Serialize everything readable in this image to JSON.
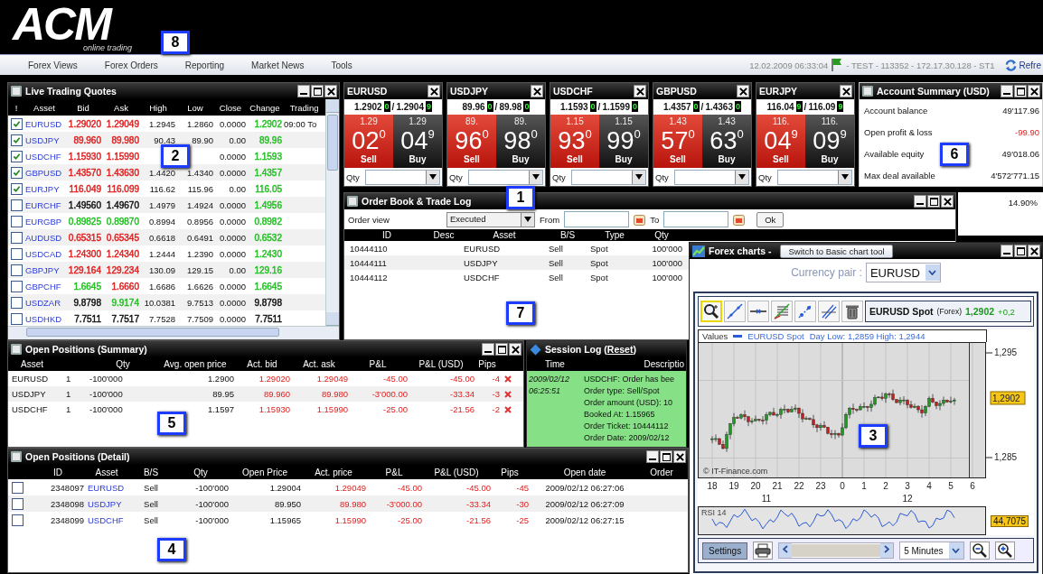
{
  "header": {
    "logo": "ACM",
    "tagline": "online trading"
  },
  "menu": [
    {
      "label": "Forex Views"
    },
    {
      "label": "Forex Orders"
    },
    {
      "label": "Reporting"
    },
    {
      "label": "Market News"
    },
    {
      "label": "Tools"
    }
  ],
  "status": {
    "datetime": "12.02.2009 06:33:04",
    "session": "- TEST - 113352 - 172.17.30.128 - ST1",
    "refresh": "Refre"
  },
  "quotes": {
    "title": "Live Trading Quotes",
    "columns": [
      "!",
      "Asset",
      "Bid",
      "Ask",
      "High",
      "Low",
      "Close",
      "Change",
      "Trading"
    ],
    "rows": [
      {
        "checked": true,
        "asset": "EURUSD",
        "bid": {
          "text": "1.29020",
          "color": "#e02020"
        },
        "ask": {
          "text": "1.29049",
          "color": "#e02020"
        },
        "high": "1.2945",
        "low": "1.2860",
        "close": "0.0000",
        "change": {
          "text": "1.2902",
          "color": "#22c022"
        },
        "trading": "09:00 To"
      },
      {
        "checked": true,
        "asset": "USDJPY",
        "bid": {
          "text": "89.960",
          "color": "#e02020"
        },
        "ask": {
          "text": "89.980",
          "color": "#e02020"
        },
        "high": "90.43",
        "low": "89.90",
        "close": "0.00",
        "change": {
          "text": "89.96",
          "color": "#22c022"
        }
      },
      {
        "checked": true,
        "asset": "USDCHF",
        "bid": {
          "text": "1.15930",
          "color": "#e02020"
        },
        "ask": {
          "text": "1.15990",
          "color": "#e02020"
        },
        "close": "0.0000",
        "change": {
          "text": "1.1593",
          "color": "#22c022"
        }
      },
      {
        "checked": true,
        "asset": "GBPUSD",
        "bid": {
          "text": "1.43570",
          "color": "#e02020"
        },
        "ask": {
          "text": "1.43630",
          "color": "#e02020"
        },
        "high": "1.4420",
        "low": "1.4340",
        "close": "0.0000",
        "change": {
          "text": "1.4357",
          "color": "#22c022"
        }
      },
      {
        "checked": true,
        "asset": "EURJPY",
        "bid": {
          "text": "116.049",
          "color": "#e02020"
        },
        "ask": {
          "text": "116.099",
          "color": "#e02020"
        },
        "high": "116.62",
        "low": "115.96",
        "close": "0.00",
        "change": {
          "text": "116.05",
          "color": "#22c022"
        }
      },
      {
        "checked": false,
        "asset": "EURCHF",
        "bid": {
          "text": "1.49560",
          "color": "#111111"
        },
        "ask": {
          "text": "1.49670",
          "color": "#111111"
        },
        "high": "1.4979",
        "low": "1.4924",
        "close": "0.0000",
        "change": {
          "text": "1.4956",
          "color": "#22c022"
        }
      },
      {
        "checked": false,
        "asset": "EURGBP",
        "bid": {
          "text": "0.89825",
          "color": "#22c022"
        },
        "ask": {
          "text": "0.89870",
          "color": "#22c022"
        },
        "high": "0.8994",
        "low": "0.8956",
        "close": "0.0000",
        "change": {
          "text": "0.8982",
          "color": "#22c022"
        }
      },
      {
        "checked": false,
        "asset": "AUDUSD",
        "bid": {
          "text": "0.65315",
          "color": "#e02020"
        },
        "ask": {
          "text": "0.65345",
          "color": "#e02020"
        },
        "high": "0.6618",
        "low": "0.6491",
        "close": "0.0000",
        "change": {
          "text": "0.6532",
          "color": "#22c022"
        }
      },
      {
        "checked": false,
        "asset": "USDCAD",
        "bid": {
          "text": "1.24300",
          "color": "#e02020"
        },
        "ask": {
          "text": "1.24340",
          "color": "#e02020"
        },
        "high": "1.2444",
        "low": "1.2390",
        "close": "0.0000",
        "change": {
          "text": "1.2430",
          "color": "#22c022"
        }
      },
      {
        "checked": false,
        "asset": "GBPJPY",
        "bid": {
          "text": "129.164",
          "color": "#e02020"
        },
        "ask": {
          "text": "129.234",
          "color": "#e02020"
        },
        "high": "130.09",
        "low": "129.15",
        "close": "0.00",
        "change": {
          "text": "129.16",
          "color": "#22c022"
        }
      },
      {
        "checked": false,
        "asset": "GBPCHF",
        "bid": {
          "text": "1.6645",
          "color": "#22c022"
        },
        "ask": {
          "text": "1.6660",
          "color": "#e02020"
        },
        "high": "1.6686",
        "low": "1.6626",
        "close": "0.0000",
        "change": {
          "text": "1.6645",
          "color": "#22c022"
        }
      },
      {
        "checked": false,
        "asset": "USDZAR",
        "bid": {
          "text": "9.8798",
          "color": "#111111"
        },
        "ask": {
          "text": "9.9174",
          "color": "#22c022"
        },
        "high": "10.0381",
        "low": "9.7513",
        "close": "0.0000",
        "change": {
          "text": "9.8798",
          "color": "#111111"
        }
      },
      {
        "checked": false,
        "asset": "USDHKD",
        "bid": {
          "text": "7.7511",
          "color": "#111111"
        },
        "ask": {
          "text": "7.7517",
          "color": "#111111"
        },
        "high": "7.7528",
        "low": "7.7509",
        "close": "0.0000",
        "change": {
          "text": "7.7511",
          "color": "#111111"
        }
      }
    ]
  },
  "tickers": [
    {
      "pair": "EURUSD",
      "bid": "1.2902",
      "bid_pip": "0",
      "separator": "/",
      "ask": "1.2904",
      "ask_pip": "9",
      "sell_prefix": "1.29",
      "sell_main": "02",
      "sell_frac": "0",
      "buy_prefix": "1.29",
      "buy_main": "04",
      "buy_frac": "9",
      "sell": "Sell",
      "buy": "Buy",
      "qty": "Qty"
    },
    {
      "pair": "USDJPY",
      "bid": "89.96",
      "bid_pip": "0",
      "separator": "/",
      "ask": "89.98",
      "ask_pip": "0",
      "sell_prefix": "89.",
      "sell_main": "96",
      "sell_frac": "0",
      "buy_prefix": "89.",
      "buy_main": "98",
      "buy_frac": "0",
      "sell": "Sell",
      "buy": "Buy",
      "qty": "Qty"
    },
    {
      "pair": "USDCHF",
      "bid": "1.1593",
      "bid_pip": "0",
      "separator": "/",
      "ask": "1.1599",
      "ask_pip": "0",
      "sell_prefix": "1.15",
      "sell_main": "93",
      "sell_frac": "0",
      "buy_prefix": "1.15",
      "buy_main": "99",
      "buy_frac": "0",
      "sell": "Sell",
      "buy": "Buy",
      "qty": "Qty"
    },
    {
      "pair": "GBPUSD",
      "bid": "1.4357",
      "bid_pip": "0",
      "separator": "/",
      "ask": "1.4363",
      "ask_pip": "0",
      "sell_prefix": "1.43",
      "sell_main": "57",
      "sell_frac": "0",
      "buy_prefix": "1.43",
      "buy_main": "63",
      "buy_frac": "0",
      "sell": "Sell",
      "buy": "Buy",
      "qty": "Qty"
    },
    {
      "pair": "EURJPY",
      "bid": "116.04",
      "bid_pip": "9",
      "separator": "/",
      "ask": "116.09",
      "ask_pip": "9",
      "sell_prefix": "116.",
      "sell_main": "04",
      "sell_frac": "9",
      "buy_prefix": "116.",
      "buy_main": "09",
      "buy_frac": "9",
      "sell": "Sell",
      "buy": "Buy",
      "qty": "Qty"
    }
  ],
  "account": {
    "title": "Account Summary (USD)",
    "rows": [
      {
        "label": "Account balance",
        "value": "49'117.96",
        "negative": false
      },
      {
        "label": "Open profit & loss",
        "value": "-99.90",
        "negative": true
      },
      {
        "label": "Available equity",
        "value": "49'018.06",
        "negative": false
      },
      {
        "label": "Max deal available",
        "value": "4'572'771.15",
        "negative": false
      }
    ]
  },
  "margin_panel": {
    "value": "14.90%"
  },
  "order_book": {
    "title": "Order Book & Trade Log",
    "order_view_label": "Order view",
    "view": "Executed",
    "from_label": "From",
    "to_label": "To",
    "ok": "Ok",
    "columns": [
      "ID",
      "Desc",
      "Asset",
      "B/S",
      "Type",
      "Qty"
    ],
    "rows": [
      {
        "id": "10444110",
        "asset": "EURUSD",
        "side": "Sell",
        "type": "Spot",
        "qty": "100'000"
      },
      {
        "id": "10444111",
        "asset": "USDJPY",
        "side": "Sell",
        "type": "Spot",
        "qty": "100'000"
      },
      {
        "id": "10444112",
        "asset": "USDCHF",
        "side": "Sell",
        "type": "Spot",
        "qty": "100'000"
      }
    ]
  },
  "summary": {
    "title": "Open Positions (Summary)",
    "columns": [
      "Asset",
      "Qty",
      "Avg. open price",
      "Act. bid",
      "Act. ask",
      "P&L",
      "P&L (USD)",
      "Pips"
    ],
    "rows": [
      {
        "asset": "EURUSD",
        "count": "1",
        "qty": "-100'000",
        "avg": "1.2900",
        "bid": "1.29020",
        "ask": "1.29049",
        "pl": "-45.00",
        "pl_usd": "-45.00",
        "pips": "-4"
      },
      {
        "asset": "USDJPY",
        "count": "1",
        "qty": "-100'000",
        "avg": "89.95",
        "bid": "89.960",
        "ask": "89.980",
        "pl": "-3'000.00",
        "pl_usd": "-33.34",
        "pips": "-3"
      },
      {
        "asset": "USDCHF",
        "count": "1",
        "qty": "-100'000",
        "avg": "1.1597",
        "bid": "1.15930",
        "ask": "1.15990",
        "pl": "-25.00",
        "pl_usd": "-21.56",
        "pips": "-2"
      }
    ]
  },
  "session_log": {
    "title_before": "Session Log (",
    "reset": "Reset",
    "title_after": ")",
    "columns": [
      "Time",
      "Descriptio"
    ],
    "entries": [
      {
        "date": "2009/02/12",
        "time": "06:25:51",
        "lines": [
          "USDCHF: Order has bee",
          "Order type: Sell/Spot",
          "Order amount (USD): 10",
          "Booked At: 1.15965",
          "Order Ticket: 10444112",
          "Order Date: 2009/02/12"
        ]
      }
    ]
  },
  "detail": {
    "title": "Open Positions (Detail)",
    "columns": [
      "ID",
      "Asset",
      "B/S",
      "Qty",
      "Open Price",
      "Act. price",
      "P&L",
      "P&L (USD)",
      "Pips",
      "Open date",
      "Order"
    ],
    "rows": [
      {
        "checked": false,
        "id": "2348097",
        "asset": "EURUSD",
        "side": "Sell",
        "qty": "-100'000",
        "open": "1.29004",
        "act": "1.29049",
        "pl": "-45.00",
        "pl_usd": "-45.00",
        "pips": "-45",
        "date": "2009/02/12 06:27:06"
      },
      {
        "checked": false,
        "id": "2348098",
        "asset": "USDJPY",
        "side": "Sell",
        "qty": "-100'000",
        "open": "89.950",
        "act": "89.980",
        "pl": "-3'000.00",
        "pl_usd": "-33.34",
        "pips": "-30",
        "date": "2009/02/12 06:27:09"
      },
      {
        "checked": false,
        "id": "2348099",
        "asset": "USDCHF",
        "side": "Sell",
        "qty": "-100'000",
        "open": "1.15965",
        "act": "1.15990",
        "pl": "-25.00",
        "pl_usd": "-21.56",
        "pips": "-25",
        "date": "2009/02/12 06:27:15"
      }
    ]
  },
  "chart_window": {
    "title": "Forex charts -",
    "switch_button": "Switch to Basic chart tool",
    "pair_label": "Currency pair :",
    "pair": "EURUSD",
    "instrument": "EURUSD Spot",
    "market": "(Forex)",
    "price": "1,2902",
    "change": "+0,2",
    "legend_label": "Values",
    "series": "EURUSD Spot",
    "day_range": "Day Low: 1,2859 High: 1,2944",
    "credit": "© IT-Finance.com",
    "y_ticks": [
      "1,295",
      "1,285"
    ],
    "last_price": "1,2902",
    "x_hours": [
      "18",
      "19",
      "20",
      "21",
      "22",
      "23",
      "0",
      "1",
      "2",
      "3",
      "4",
      "5",
      "6"
    ],
    "x_days": [
      "11",
      "12"
    ],
    "rsi_label": "RSI 14",
    "rsi_value": "44,7075",
    "settings": "Settings",
    "interval": "5 Minutes"
  },
  "callouts": [
    {
      "label": "8"
    },
    {
      "label": "2"
    },
    {
      "label": "6"
    },
    {
      "label": "1"
    },
    {
      "label": "7"
    },
    {
      "label": "5"
    },
    {
      "label": "3"
    },
    {
      "label": "4"
    }
  ]
}
